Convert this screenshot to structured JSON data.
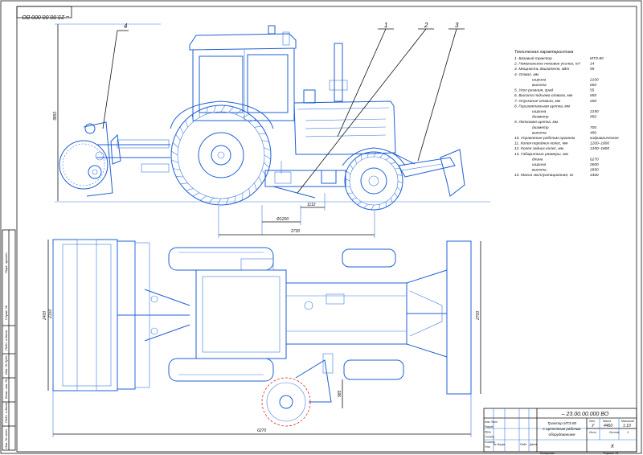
{
  "drawing": {
    "number_top": "– 23.00.00.000 ВО",
    "number_stamp": "– 23.00.00.000 ВО",
    "title_lines": [
      "Трактор МТЗ-80",
      "с щеточным рабочим",
      "оборудованием"
    ],
    "letter": "У",
    "mass": "4460",
    "scale": "1:10",
    "stamp_headers": [
      "Лит.",
      "Масса",
      "Масштаб"
    ],
    "sheet_label": "Лист",
    "sheets_label": "Листов",
    "sheets_count": "1",
    "org": "К",
    "footer_copy": "Копировал",
    "footer_format": "Формат  А1",
    "stamp_rows": [
      "Изм. Лист",
      "Разраб.",
      "Пров.",
      "Т.контр.",
      "Н.контр.",
      "Утв."
    ],
    "stamp_cols": [
      "№ докум.",
      "Подп.",
      "Дата"
    ]
  },
  "side_strip": {
    "labels": [
      "Перв. примен.",
      "Справ. №",
      "Подп. и дата",
      "Инв. № дубл.",
      "Взам. инв. №",
      "Подп. и дата",
      "Инв. № подл."
    ]
  },
  "callouts": [
    "4",
    "1",
    "2",
    "3"
  ],
  "dimensions": {
    "height": "3850",
    "d_wheel": "Ф1200",
    "offset": "1112",
    "base": "2730",
    "width_outer": "2400",
    "width_inner": "2150",
    "width_right": "2700",
    "brush_offset": "985",
    "length": "6270"
  },
  "specs": {
    "title": "Техническая характеристика",
    "items": [
      {
        "label": "1. Базовый трактор",
        "value": "МТЗ-80"
      },
      {
        "label": "2. Номинальное тяговое усилие, кН",
        "value": "14"
      },
      {
        "label": "3. Мощность двигателя, кВт",
        "value": "59"
      },
      {
        "label": "4. Отвал, мм",
        "value": ""
      },
      {
        "label": "ширина",
        "value": "2100"
      },
      {
        "label": "высота",
        "value": "650"
      },
      {
        "label": "5. Угол резания, град",
        "value": "55"
      },
      {
        "label": "6. Высота подъема отвала, мм",
        "value": "650"
      },
      {
        "label": "7. Опускание отвала, мм",
        "value": "200"
      },
      {
        "label": "8. Горизонтальная щетка, мм",
        "value": ""
      },
      {
        "label": "ширина",
        "value": "2150"
      },
      {
        "label": "диаметр",
        "value": "950"
      },
      {
        "label": "9. Лотковая щетка, мм",
        "value": ""
      },
      {
        "label": "диаметр",
        "value": "700"
      },
      {
        "label": "высота",
        "value": "490"
      },
      {
        "label": "10. Управление рабочим органом",
        "value": "гидравлическое"
      },
      {
        "label": "11. Колея передних колес, мм",
        "value": "1200–1800"
      },
      {
        "label": "12. Колея задних колес, мм",
        "value": "1350–1800"
      },
      {
        "label": "13. Габаритные размеры, мм",
        "value": ""
      },
      {
        "label": "длина",
        "value": "6270"
      },
      {
        "label": "ширина",
        "value": "2600"
      },
      {
        "label": "высота",
        "value": "2850"
      },
      {
        "label": "14. Масса эксплуатационная, кг",
        "value": "4460"
      }
    ]
  }
}
